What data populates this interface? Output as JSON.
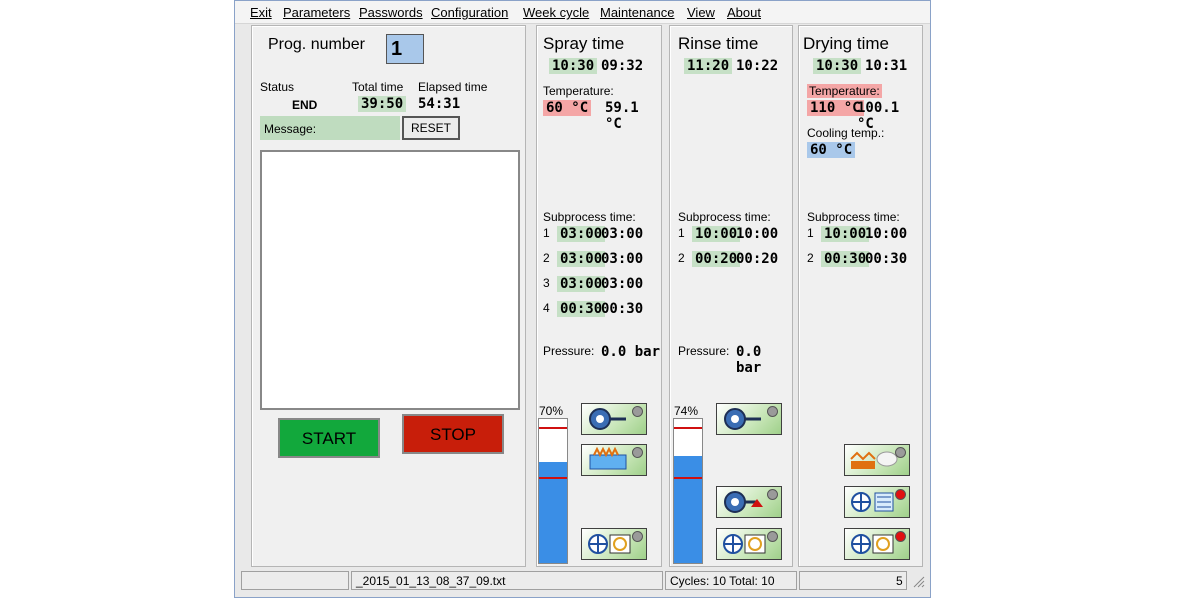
{
  "menu": [
    "Exit",
    "Parameters",
    "Passwords",
    "Configuration",
    "Week cycle",
    "Maintenance",
    "View",
    "About"
  ],
  "left": {
    "prog_label": "Prog. number",
    "prog_value": "1",
    "status_label": "Status",
    "status_value": "END",
    "total_label": "Total time",
    "total_value": "39:50",
    "elapsed_label": "Elapsed time",
    "elapsed_value": "54:31",
    "message_label": "Message:",
    "reset_label": "RESET",
    "start_label": "START",
    "stop_label": "STOP"
  },
  "spray": {
    "title": "Spray time",
    "set": "10:30",
    "actual": "09:32",
    "temp_label": "Temperature:",
    "temp_set": "60 °C",
    "temp_actual": "59.1 °C",
    "sub_label": "Subprocess time:",
    "subs": [
      {
        "n": "1",
        "set": "03:00",
        "actual": "03:00"
      },
      {
        "n": "2",
        "set": "03:00",
        "actual": "03:00"
      },
      {
        "n": "3",
        "set": "03:00",
        "actual": "03:00"
      },
      {
        "n": "4",
        "set": "00:30",
        "actual": "00:30"
      }
    ],
    "pressure_label": "Pressure:",
    "pressure_value": "0.0 bar",
    "level_label": "70%",
    "level": 0.7
  },
  "rinse": {
    "title": "Rinse time",
    "set": "11:20",
    "actual": "10:22",
    "sub_label": "Subprocess time:",
    "subs": [
      {
        "n": "1",
        "set": "10:00",
        "actual": "10:00"
      },
      {
        "n": "2",
        "set": "00:20",
        "actual": "00:20"
      }
    ],
    "pressure_label": "Pressure:",
    "pressure_value": "0.0 bar",
    "level_label": "74%",
    "level": 0.74
  },
  "drying": {
    "title": "Drying time",
    "set": "10:30",
    "actual": "10:31",
    "temp_label": "Temperature:",
    "temp_set": "110 °C",
    "temp_actual": "100.1 °C",
    "cool_label": "Cooling temp.:",
    "cool_set": "60 °C",
    "sub_label": "Subprocess time:",
    "subs": [
      {
        "n": "1",
        "set": "10:00",
        "actual": "10:00"
      },
      {
        "n": "2",
        "set": "00:30",
        "actual": "00:30"
      }
    ]
  },
  "statusbar": {
    "file": "_2015_01_13_08_37_09.txt",
    "cycles": "Cycles: 10 Total: 10",
    "extra": "5"
  },
  "icons": {
    "pump": "pump-icon",
    "heater": "heater-icon",
    "fan_heat": "fan-heater-icon",
    "dryer_fan": "dryer-fan-icon",
    "exhaust": "exhaust-icon",
    "cooler": "cooler-icon"
  }
}
